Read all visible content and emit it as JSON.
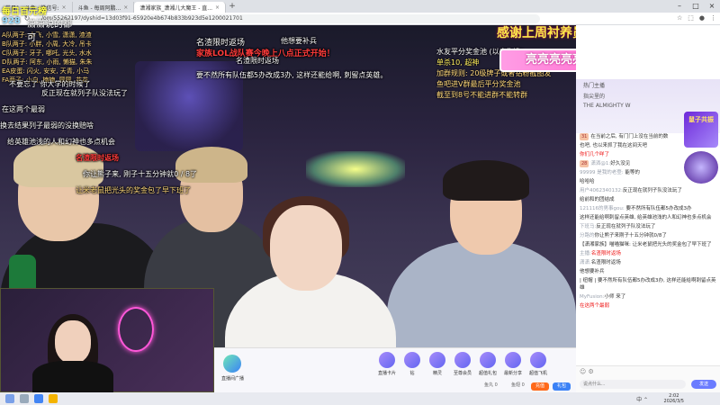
{
  "browser": {
    "tabs": [
      {
        "label": "节目1 - 斗鱼 · 微信号:",
        "active": false
      },
      {
        "label": "斗鱼 - 每周阿鹏...",
        "active": false
      },
      {
        "label": "潇湘家族_潇湘儿大魔王 - 直...",
        "active": true
      }
    ],
    "url": "/om/55262197/dyshid=13d03f91-65920e4b674b833b923d5e1200021701"
  },
  "overlay": {
    "logo_title": "每日百元榜",
    "logo_count": "928",
    "logo_sub": "潇潇说的都可",
    "ranks": [
      "A队两子: 小飞, 小雪, 潇潇, 渣渣",
      "B队两子: 小胖, 小周, 大冷, 吊卡",
      "C队两子: 牙子, 哪吒, 光头, 水水",
      "D队两子: 阿东, 小雨, 懒猫, 朱朱",
      "EA皮蛋: 闪火, 安安, 天青, 小马",
      "FA两子: 小白, 楠楠, 圆圆, 花花"
    ],
    "tip_lines": [
      "水友平分奖金池 (以广为准)",
      "单杀10, 超神",
      "加群规则: 20级牌子或者钻粉截图发",
      "鱼吧进V群最后平分奖金池",
      "截至到8号不能进群不能转群"
    ],
    "thanks": "感谢上周衬养员",
    "boss": "亮亮亮亮亮亮大魔王"
  },
  "danmaku": [
    {
      "text": "名渣限时返场",
      "color": "#ffffff",
      "size": 9
    },
    {
      "text": "他想要补兵",
      "color": "#ffffff",
      "size": 8
    },
    {
      "text": "家族LOL战队赛今晚上八点正式开始！",
      "color": "#ff3b3b",
      "size": 9
    },
    {
      "text": "名渣限时返场",
      "color": "#ffffff",
      "size": 9
    },
    {
      "text": "不要忘了 你大学的时候了",
      "color": "#ffffff",
      "size": 8
    },
    {
      "text": "要不然所有队伍都5办改成3办, 这样还能给啊, 刺留点英雄。",
      "color": "#ffffff",
      "size": 8
    },
    {
      "text": "给英雄池浅的人和幻神也多点机会",
      "color": "#ffffff",
      "size": 8
    },
    {
      "text": "反正现在就列子队没法玩了",
      "color": "#ffffff",
      "size": 8
    },
    {
      "text": "在这两个最弱",
      "color": "#ffffff",
      "size": 8
    },
    {
      "text": "换去结果列子最弱的没换赔啥",
      "color": "#ffffff",
      "size": 8
    },
    {
      "text": "给英雄池浅的人和幻神也多点机会",
      "color": "#ffffff",
      "size": 8
    },
    {
      "text": "名渣限时返场",
      "color": "#ff3b3b",
      "size": 8
    },
    {
      "text": "你让熊子来, 刚子十五分钟就0 / 8了",
      "color": "#ffffff",
      "size": 8
    },
    {
      "text": "让米老鼠把光头的奖金包了早下班了",
      "color": "#ffd87a",
      "size": 8
    }
  ],
  "gifts": [
    {
      "label": "直播卡片"
    },
    {
      "label": "钻"
    },
    {
      "label": "精灵"
    },
    {
      "label": "至尊会员"
    },
    {
      "label": "超值礼包"
    },
    {
      "label": "最新分享"
    },
    {
      "label": "超值"
    },
    {
      "label": "超值飞机"
    }
  ],
  "giftbar": {
    "left_label": "直播间广播",
    "balance": "鱼丸 0",
    "yuchi": "鱼翅 0",
    "recharge": "充值",
    "send_gift": "礼包"
  },
  "webcam_label": "",
  "chat": {
    "banner_rows": [
      "热门主播",
      "指尖里的",
      "THE ALMIGHTY W"
    ],
    "badge_text": "鼠子共振",
    "messages": [
      {
        "lv": "31",
        "user": "",
        "text": "在当前之后, 有门门上没在当前的数"
      },
      {
        "lv": "",
        "user": "",
        "text": "也吧, 也以来抓了我在这间天吧"
      },
      {
        "lv": "",
        "user": "",
        "text": "你们几个咩了"
      },
      {
        "lv": "28",
        "user": "潇洒@1:",
        "text": "好久没见"
      },
      {
        "lv": "",
        "user": "99999 是我的老登: ",
        "text": "能等的"
      },
      {
        "lv": "",
        "user": "",
        "text": "哈哈哈"
      },
      {
        "lv": "",
        "user": "用户4062340132:",
        "text": "反正现在就列子队没法玩了"
      },
      {
        "lv": "",
        "user": "",
        "text": "给前和的团结成"
      },
      {
        "lv": "",
        "user": "121116的男事gou: ",
        "text": "要不然所有队伍都5办改成3办"
      },
      {
        "lv": "",
        "user": "",
        "text": "这样还能给啊刺留点英雄, 给英雄池浅的人和幻神也多点机会"
      },
      {
        "lv": "",
        "user": "下班马:",
        "text": "反正现在就列子队没法玩了"
      },
      {
        "lv": "",
        "user": "分路的",
        "text": "你让熊子来刚子十五分钟就0/8了"
      },
      {
        "lv": "",
        "user": "",
        "text": "【潇湘家族】喵喵猫咪: 让米老鼠把光头的奖金包了早下班了"
      },
      {
        "lv": "",
        "user": "主播:",
        "text": "名渣限时返场"
      },
      {
        "lv": "",
        "user": "潇潇.",
        "text": "名渣限时返场"
      },
      {
        "lv": "",
        "user": "",
        "text": "他想要补兵"
      },
      {
        "lv": "",
        "user": "",
        "text": "| 纽帽 | 要不然所有队伍都5办改成3办, 这样还能给啊刺留点英雄"
      },
      {
        "lv": "",
        "user": "MyFusion:",
        "text": "小师 来了"
      }
    ],
    "input_placeholder": "说点什么...",
    "send_label": "发送",
    "bottom_line": "在这两个最弱"
  },
  "taskbar": {
    "time": "2:02",
    "date": "2026/3/5",
    "tray": "中 ⌃"
  }
}
